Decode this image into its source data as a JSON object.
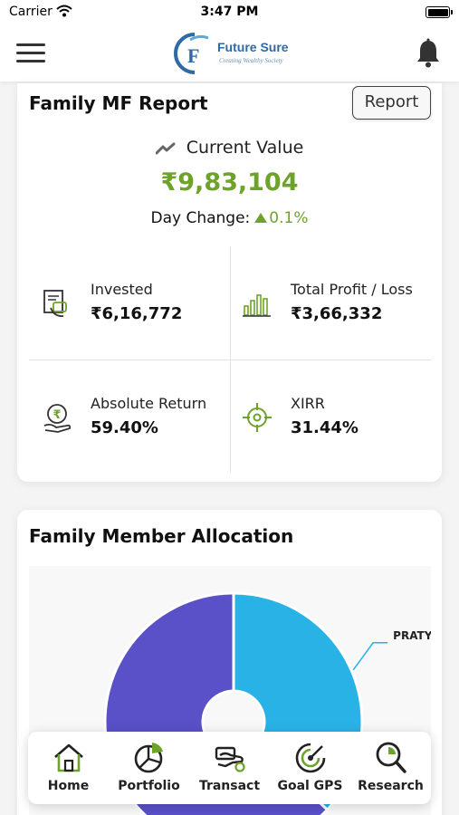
{
  "status_bar": {
    "carrier": "Carrier",
    "time": "3:47 PM"
  },
  "header": {
    "logo_icon_text": "F",
    "brand": "Future Sure",
    "tagline": "Creating Wealthy Society"
  },
  "report_card": {
    "title": "Family MF Report",
    "report_button": "Report",
    "current_value_label": "Current Value",
    "current_value": "₹9,83,104",
    "day_change_label": "Day Change:",
    "day_change_value": "0.1%",
    "day_change_direction": "up",
    "stats": [
      {
        "label": "Invested",
        "value": "₹6,16,772",
        "icon": "invested-icon"
      },
      {
        "label": "Total Profit / Loss",
        "value": "₹3,66,332",
        "icon": "bar-chart-icon"
      },
      {
        "label": "Absolute Return",
        "value": "59.40%",
        "icon": "rupee-hand-icon"
      },
      {
        "label": "XIRR",
        "value": "31.44%",
        "icon": "target-icon"
      }
    ]
  },
  "allocation_card": {
    "title": "Family Member Allocation"
  },
  "chart_data": {
    "type": "pie",
    "donut": true,
    "slices": [
      {
        "label": "PRATYUSH",
        "value": 37,
        "color": "#29b2e6"
      },
      {
        "label": "",
        "value": 63,
        "color": "#5a50c8"
      }
    ]
  },
  "bottom_nav": [
    {
      "label": "Home",
      "icon": "home-icon"
    },
    {
      "label": "Portfolio",
      "icon": "portfolio-pie-icon"
    },
    {
      "label": "Transact",
      "icon": "transact-hand-icon"
    },
    {
      "label": "Goal GPS",
      "icon": "goal-gps-icon"
    },
    {
      "label": "Research",
      "icon": "research-magnifier-icon"
    }
  ],
  "colors": {
    "accent_green": "#6ea32a",
    "brand_blue": "#2d6aa6",
    "pie_primary": "#5a50c8",
    "pie_secondary": "#29b2e6"
  }
}
